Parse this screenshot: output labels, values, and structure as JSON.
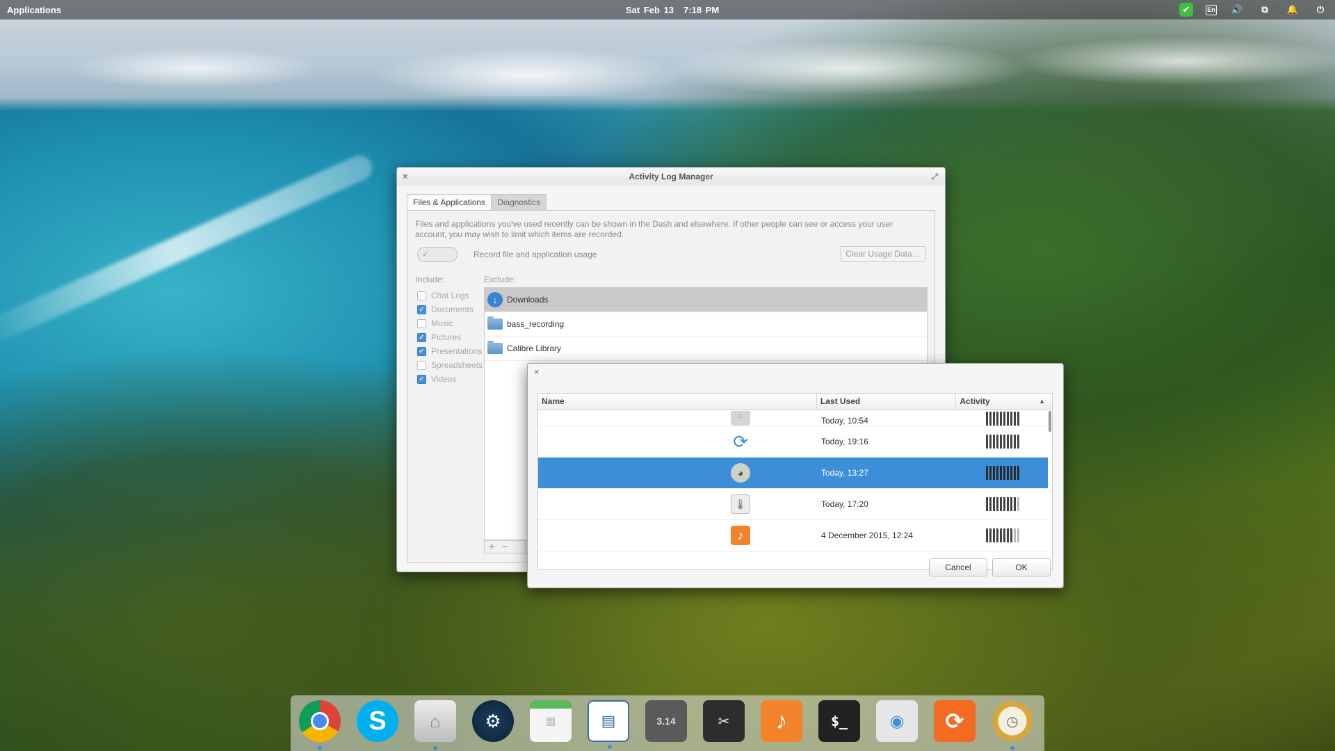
{
  "top_panel": {
    "applications": "Applications",
    "date": "Sat Feb 13",
    "time": "7:18 PM",
    "indicators": [
      "check-icon",
      "keyboard-icon",
      "volume-icon",
      "network-icon",
      "notification-icon",
      "power-icon"
    ],
    "keyboard_label": "En"
  },
  "main_window": {
    "title": "Activity Log Manager",
    "tabs": [
      {
        "label": "Files & Applications",
        "active": true
      },
      {
        "label": "Diagnostics",
        "active": false
      }
    ],
    "description": "Files and applications you've used recently can be shown in the Dash and elsewhere. If other people can see or access your user account, you may wish to limit which items are recorded.",
    "record_label": "Record file and application usage",
    "record_enabled": true,
    "clear_button": "Clear Usage Data…",
    "include_label": "Include:",
    "exclude_label": "Exclude:",
    "include_items": [
      {
        "label": "Chat Logs",
        "checked": false
      },
      {
        "label": "Documents",
        "checked": true
      },
      {
        "label": "Music",
        "checked": false
      },
      {
        "label": "Pictures",
        "checked": true
      },
      {
        "label": "Presentations",
        "checked": true
      },
      {
        "label": "Spreadsheets",
        "checked": false
      },
      {
        "label": "Videos",
        "checked": true
      }
    ],
    "exclude_items": [
      {
        "label": "Downloads",
        "icon": "download-folder-icon",
        "selected": true
      },
      {
        "label": "bass_recording",
        "icon": "folder-icon",
        "selected": false
      },
      {
        "label": "Calibre Library",
        "icon": "folder-icon",
        "selected": false
      }
    ],
    "add_symbol": "+",
    "remove_symbol": "−"
  },
  "dialog": {
    "columns": {
      "name": "Name",
      "last_used": "Last Used",
      "activity": "Activity"
    },
    "rows": [
      {
        "icon": "home-app-icon",
        "last_used": "Today, 10:54",
        "activity_full": 10,
        "activity_total": 10,
        "partial": true
      },
      {
        "icon": "sync-icon",
        "last_used": "Today, 19:16",
        "activity_full": 10,
        "activity_total": 10,
        "selected": false
      },
      {
        "icon": "gimp-icon",
        "last_used": "Today, 13:27",
        "activity_full": 10,
        "activity_total": 10,
        "selected": true
      },
      {
        "icon": "thermometer-icon",
        "last_used": "Today, 17:20",
        "activity_full": 9,
        "activity_total": 10,
        "selected": false
      },
      {
        "icon": "music-icon",
        "last_used": "4 December 2015, 12:24",
        "activity_full": 8,
        "activity_total": 10,
        "selected": false
      }
    ],
    "cancel": "Cancel",
    "ok": "OK"
  },
  "dock": {
    "items": [
      {
        "name": "chrome-icon",
        "glyph": ""
      },
      {
        "name": "skype-icon",
        "glyph": "S"
      },
      {
        "name": "home-folder-icon",
        "glyph": "⌂"
      },
      {
        "name": "steam-icon",
        "glyph": "⚙"
      },
      {
        "name": "calendar-icon",
        "glyph": "▦"
      },
      {
        "name": "image-viewer-icon",
        "glyph": "▤"
      },
      {
        "name": "calculator-icon",
        "glyph": "3.14"
      },
      {
        "name": "screenshot-icon",
        "glyph": "✂"
      },
      {
        "name": "music-player-icon",
        "glyph": "♪"
      },
      {
        "name": "terminal-icon",
        "glyph": "$_"
      },
      {
        "name": "switchboard-icon",
        "glyph": "◉"
      },
      {
        "name": "software-update-icon",
        "glyph": "⟳"
      },
      {
        "name": "time-machine-icon",
        "glyph": "◷"
      }
    ],
    "accent": "#3d8ed8"
  }
}
